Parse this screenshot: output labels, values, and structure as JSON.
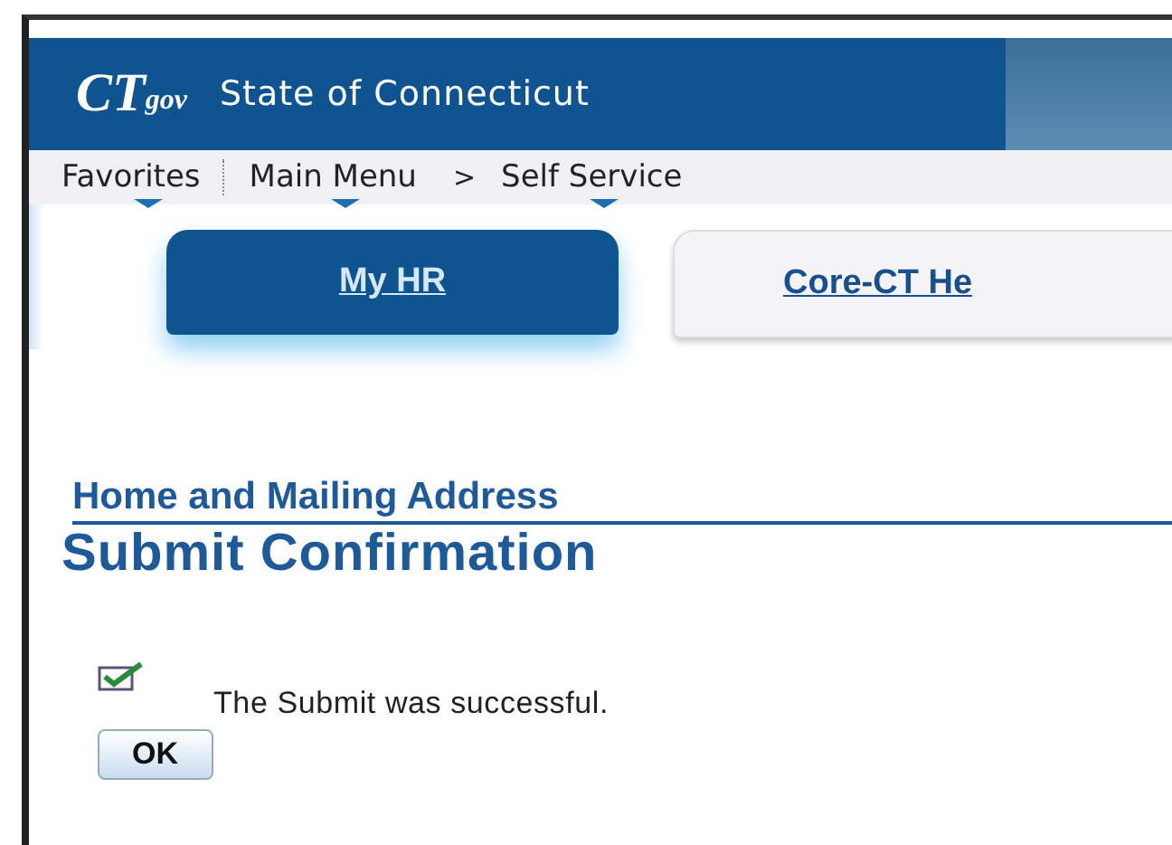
{
  "header": {
    "logo_main": "CT",
    "logo_sub": "gov",
    "title": "State of Connecticut"
  },
  "nav": [
    {
      "kind": "menu",
      "label": "Favorites"
    },
    {
      "kind": "menu",
      "label": "Main Menu"
    },
    {
      "kind": "separator",
      "label": ">"
    },
    {
      "kind": "menu",
      "label": "Self Service"
    }
  ],
  "tabs": [
    {
      "label": "My HR",
      "selected": true
    },
    {
      "label": "Core-CT He",
      "selected": false
    }
  ],
  "section_title": "Home and Mailing Address",
  "page_title": "Submit Confirmation",
  "message": "The Submit was successful.",
  "button": "OK"
}
